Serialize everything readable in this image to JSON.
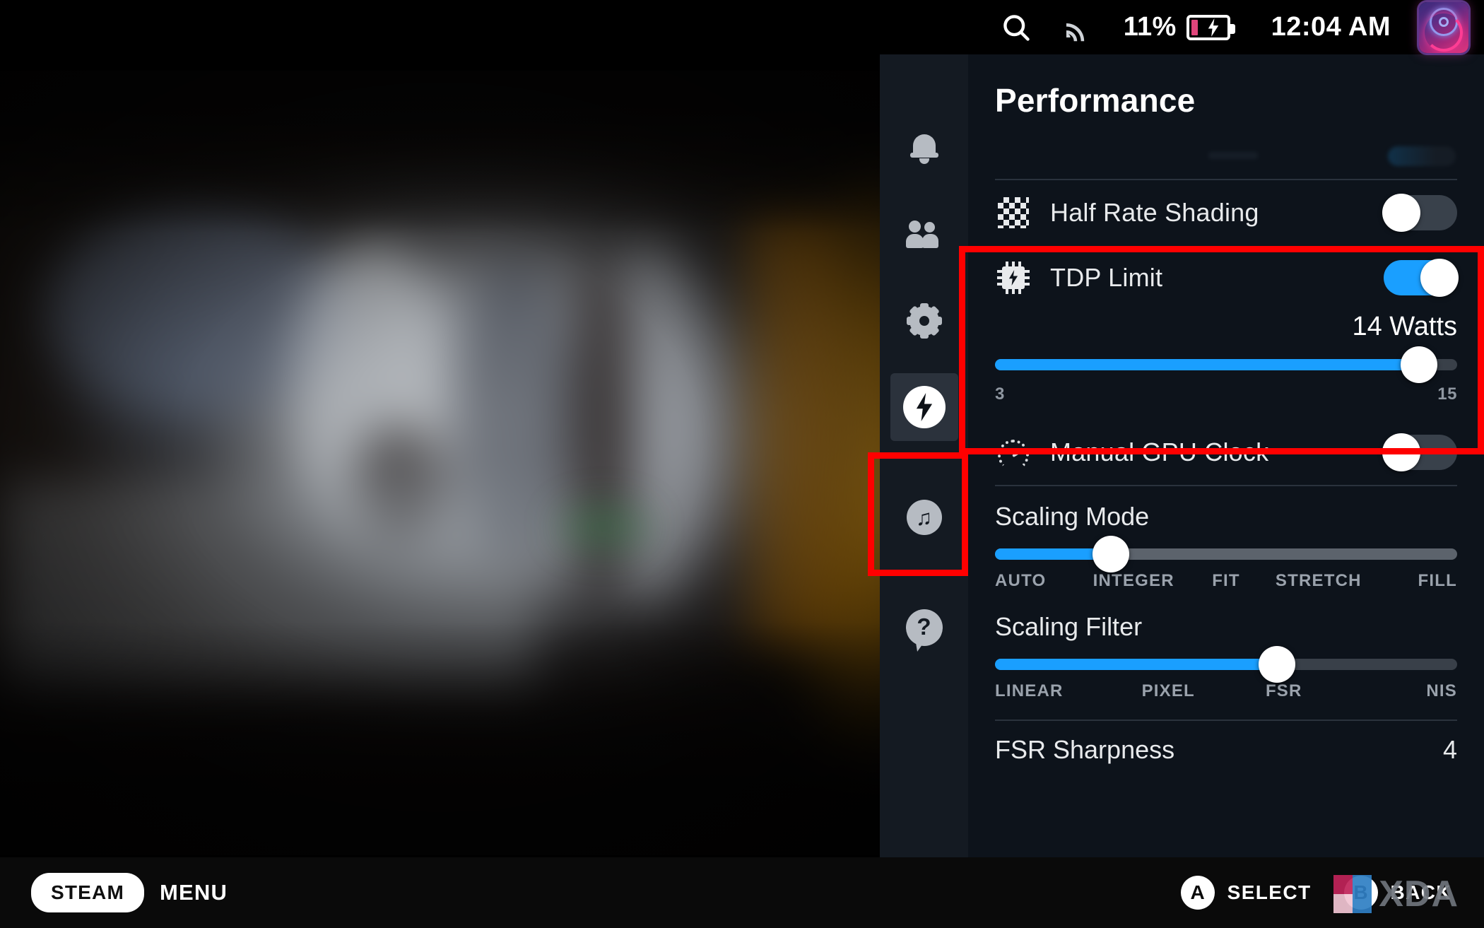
{
  "topbar": {
    "search_icon": "search-icon",
    "wifi_icon": "wifi-icon",
    "battery_percent": "11%",
    "battery_icon": "battery-charging-icon",
    "time": "12:04 AM",
    "avatar_icon": "user-avatar"
  },
  "sidebar": {
    "items": [
      {
        "name": "notifications",
        "icon": "bell-icon",
        "active": false
      },
      {
        "name": "friends",
        "icon": "people-icon",
        "active": false
      },
      {
        "name": "settings",
        "icon": "gear-icon",
        "active": false
      },
      {
        "name": "performance",
        "icon": "lightning-bolt-icon",
        "active": true
      },
      {
        "name": "music",
        "icon": "music-note-icon",
        "active": false
      },
      {
        "name": "help",
        "icon": "question-mark-icon",
        "active": false
      }
    ]
  },
  "panel": {
    "title": "Performance",
    "half_rate_shading": {
      "label": "Half Rate Shading",
      "icon": "checkerboard-icon",
      "toggle_state": "off"
    },
    "tdp_limit": {
      "label": "TDP Limit",
      "icon": "cpu-chip-icon",
      "toggle_state": "on",
      "value_label": "14 Watts",
      "value": 14,
      "min": 3,
      "max": 15,
      "min_label": "3",
      "max_label": "15"
    },
    "manual_gpu_clock": {
      "label": "Manual GPU Clock",
      "icon": "gauge-icon",
      "toggle_state": "off"
    },
    "scaling_mode": {
      "label": "Scaling Mode",
      "options": [
        "AUTO",
        "INTEGER",
        "FIT",
        "STRETCH",
        "FILL"
      ],
      "selected": "INTEGER",
      "selected_index": 1
    },
    "scaling_filter": {
      "label": "Scaling Filter",
      "options": [
        "LINEAR",
        "PIXEL",
        "FSR",
        "NIS"
      ],
      "selected": "FSR",
      "selected_index": 2
    },
    "fsr_sharpness": {
      "label": "FSR Sharpness",
      "value": "4"
    }
  },
  "bottombar": {
    "steam_label": "STEAM",
    "menu_label": "MENU",
    "select_button": "A",
    "select_label": "SELECT",
    "back_button": "B",
    "back_label": "BACK"
  },
  "watermark": {
    "text": "XDA"
  },
  "colors": {
    "accent_blue": "#1a9fff",
    "panel_bg": "#0d131b",
    "sidebar_bg": "#141a22",
    "annotation_red": "#ff0000",
    "battery_level": "#e0457b"
  }
}
